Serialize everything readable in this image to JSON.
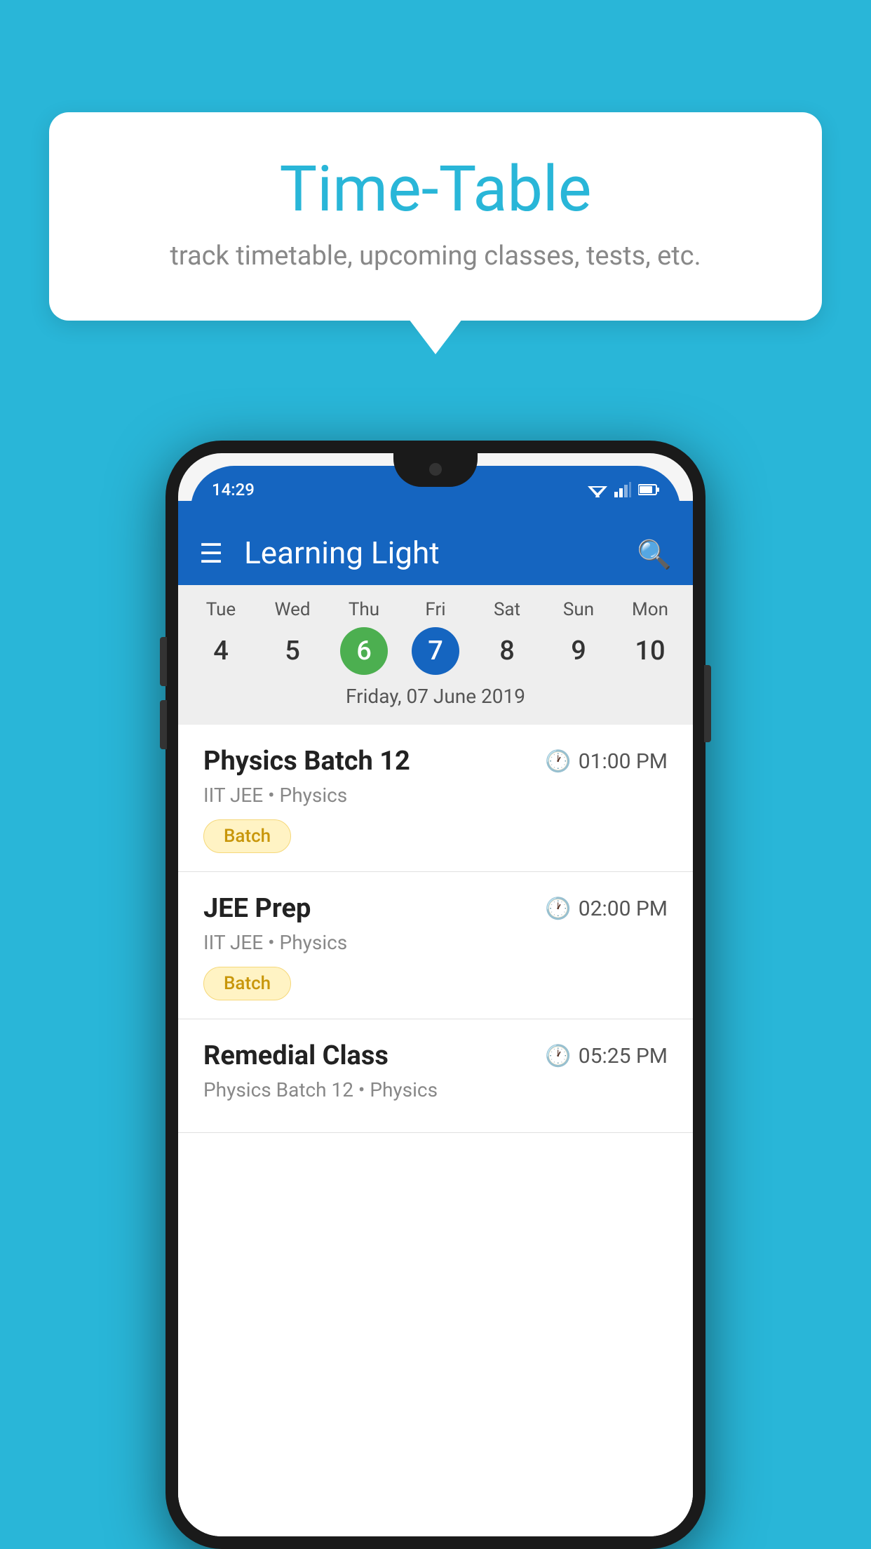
{
  "background_color": "#29B6D8",
  "tooltip": {
    "title": "Time-Table",
    "subtitle": "track timetable, upcoming classes, tests, etc."
  },
  "app": {
    "title": "Learning Light",
    "status_time": "14:29"
  },
  "calendar": {
    "days": [
      {
        "name": "Tue",
        "num": "4",
        "state": "normal"
      },
      {
        "name": "Wed",
        "num": "5",
        "state": "normal"
      },
      {
        "name": "Thu",
        "num": "6",
        "state": "today"
      },
      {
        "name": "Fri",
        "num": "7",
        "state": "selected"
      },
      {
        "name": "Sat",
        "num": "8",
        "state": "normal"
      },
      {
        "name": "Sun",
        "num": "9",
        "state": "normal"
      },
      {
        "name": "Mon",
        "num": "10",
        "state": "normal"
      }
    ],
    "selected_date_label": "Friday, 07 June 2019"
  },
  "schedule": [
    {
      "title": "Physics Batch 12",
      "time": "01:00 PM",
      "subtitle": "IIT JEE • Physics",
      "tag": "Batch"
    },
    {
      "title": "JEE Prep",
      "time": "02:00 PM",
      "subtitle": "IIT JEE • Physics",
      "tag": "Batch"
    },
    {
      "title": "Remedial Class",
      "time": "05:25 PM",
      "subtitle": "Physics Batch 12 • Physics",
      "tag": ""
    }
  ]
}
